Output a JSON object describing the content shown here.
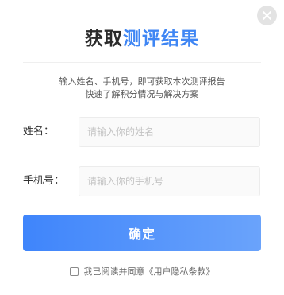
{
  "dialog": {
    "close_icon": "close-icon",
    "title_part1": "获取",
    "title_part2": "测评结果",
    "title_accent_color": "#3f86f4",
    "subtitle_line1": "输入姓名、手机号，即可获取本次测评报告",
    "subtitle_line2": "快速了解积分情况与解决方案"
  },
  "form": {
    "name_label": "姓名：",
    "name_placeholder": "请输入你的姓名",
    "phone_label": "手机号：",
    "phone_placeholder": "请输入你的手机号"
  },
  "actions": {
    "confirm_label": "确定",
    "agree_text": "我已阅读并同意《用户隐私条款》"
  }
}
